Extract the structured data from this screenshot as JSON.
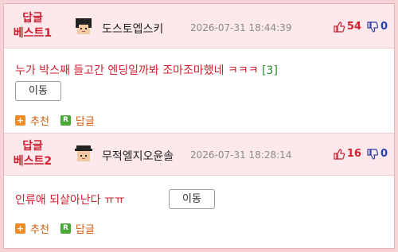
{
  "comments": [
    {
      "rank_line1": "답글",
      "rank_line2": "베스트1",
      "nick": "도스토엡스키",
      "time": "2026-07-31 18:44:39",
      "up": "54",
      "down": "0",
      "text": "누가 박스째 들고간 엔딩일까봐 조마조마했네 ㅋㅋㅋ",
      "replies": "[3]",
      "move_label": "이동",
      "recommend_label": "추천",
      "reply_label": "답글"
    },
    {
      "rank_line1": "답글",
      "rank_line2": "베스트2",
      "nick": "무적엘지오윤솔",
      "time": "2026-07-31 18:28:14",
      "up": "16",
      "down": "0",
      "text": "인류애 되살아난다 ㅠㅠ",
      "move_label": "이동",
      "recommend_label": "추천",
      "reply_label": "답글"
    }
  ],
  "icons": {
    "avatar": "pixel-face-avatar-icon",
    "up": "thumbs-up-icon",
    "down": "thumbs-down-icon",
    "recommend": "plus-icon",
    "reply": "r-icon"
  }
}
